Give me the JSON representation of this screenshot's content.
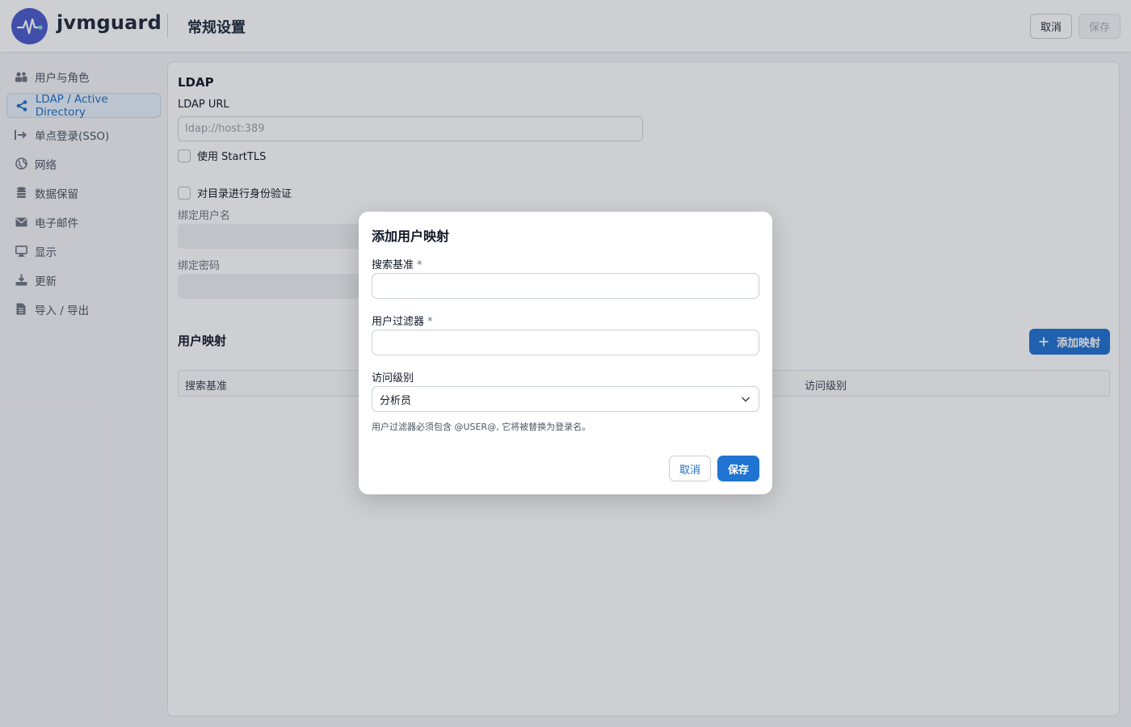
{
  "header": {
    "brand": "jvmguard",
    "page_title": "常规设置",
    "cancel_label": "取消",
    "save_label": "保存"
  },
  "sidebar": {
    "items": [
      {
        "label": "用户与角色",
        "icon": "users-icon"
      },
      {
        "label": "LDAP / Active Directory",
        "icon": "share-icon",
        "active": true
      },
      {
        "label": "单点登录(SSO)",
        "icon": "sign-in-icon"
      },
      {
        "label": "网络",
        "icon": "globe-icon"
      },
      {
        "label": "数据保留",
        "icon": "database-icon"
      },
      {
        "label": "电子邮件",
        "icon": "envelope-icon"
      },
      {
        "label": "显示",
        "icon": "monitor-icon"
      },
      {
        "label": "更新",
        "icon": "download-icon"
      },
      {
        "label": "导入 / 导出",
        "icon": "file-icon"
      }
    ]
  },
  "ldap": {
    "section_title": "LDAP",
    "url_label": "LDAP URL",
    "url_placeholder": "ldap://host:389",
    "starttls_label": "使用 StartTLS",
    "auth_label": "对目录进行身份验证",
    "bind_user_label": "绑定用户名",
    "bind_password_label": "绑定密码"
  },
  "mapping": {
    "title": "用户映射",
    "add_button": "添加映射",
    "columns": [
      "搜索基准",
      "访问级别"
    ]
  },
  "modal": {
    "title": "添加用户映射",
    "search_base_label": "搜索基准",
    "user_filter_label": "用户过滤器",
    "required_mark": "*",
    "access_level_label": "访问级别",
    "access_level_value": "分析员",
    "hint": "用户过滤器必须包含 @USER@, 它将被替换为登录名。",
    "cancel_label": "取消",
    "save_label": "保存"
  },
  "colors": {
    "accent": "#1f73d1",
    "logo_bg": "#4b5bcc",
    "active_item_bg": "#e8f1fb"
  }
}
